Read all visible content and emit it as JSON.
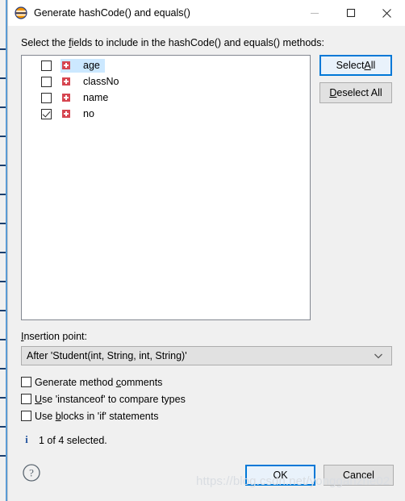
{
  "window": {
    "title": "Generate hashCode() and equals()",
    "icon": "eclipse-icon",
    "controls": {
      "minimize": "minimize-icon",
      "maximize": "maximize-icon",
      "close": "close-icon"
    }
  },
  "prompt": {
    "before": "Select the ",
    "mnemonic": "f",
    "after": "ields to include in the hashCode() and equals() methods:"
  },
  "fields": [
    {
      "name": "age",
      "checked": false,
      "selected": true,
      "icon": "private-field-icon"
    },
    {
      "name": "classNo",
      "checked": false,
      "selected": false,
      "icon": "private-field-icon"
    },
    {
      "name": "name",
      "checked": false,
      "selected": false,
      "icon": "private-field-icon"
    },
    {
      "name": "no",
      "checked": true,
      "selected": false,
      "icon": "private-field-icon"
    }
  ],
  "side_buttons": {
    "select_all": {
      "before": "Select ",
      "mnemonic": "A",
      "after": "ll"
    },
    "deselect_all": {
      "before": "",
      "mnemonic": "D",
      "after": "eselect All"
    }
  },
  "insertion_point": {
    "label_mnemonic": "I",
    "label_rest": "nsertion point:",
    "value": "After 'Student(int, String, int, String)'",
    "arrow": "chevron-down-icon"
  },
  "options": [
    {
      "before": "Generate method ",
      "mnemonic": "c",
      "after": "omments",
      "checked": false,
      "name": "generate-method-comments"
    },
    {
      "before": "",
      "mnemonic": "U",
      "after": "se 'instanceof' to compare types",
      "checked": false,
      "name": "use-instanceof"
    },
    {
      "before": "Use ",
      "mnemonic": "b",
      "after": "locks in 'if' statements",
      "checked": false,
      "name": "use-blocks-in-if"
    }
  ],
  "status": {
    "icon": "info-icon",
    "glyph": "i",
    "text": "1 of 4 selected."
  },
  "footer": {
    "help": "help-icon",
    "ok": "OK",
    "cancel": "Cancel"
  },
  "watermark": "https://blog.csdn.net/yongganzhe02",
  "colors": {
    "accent": "#0078d7",
    "selection": "#cce8ff",
    "field_icon": "#d64550",
    "info": "#1c4f9c"
  }
}
